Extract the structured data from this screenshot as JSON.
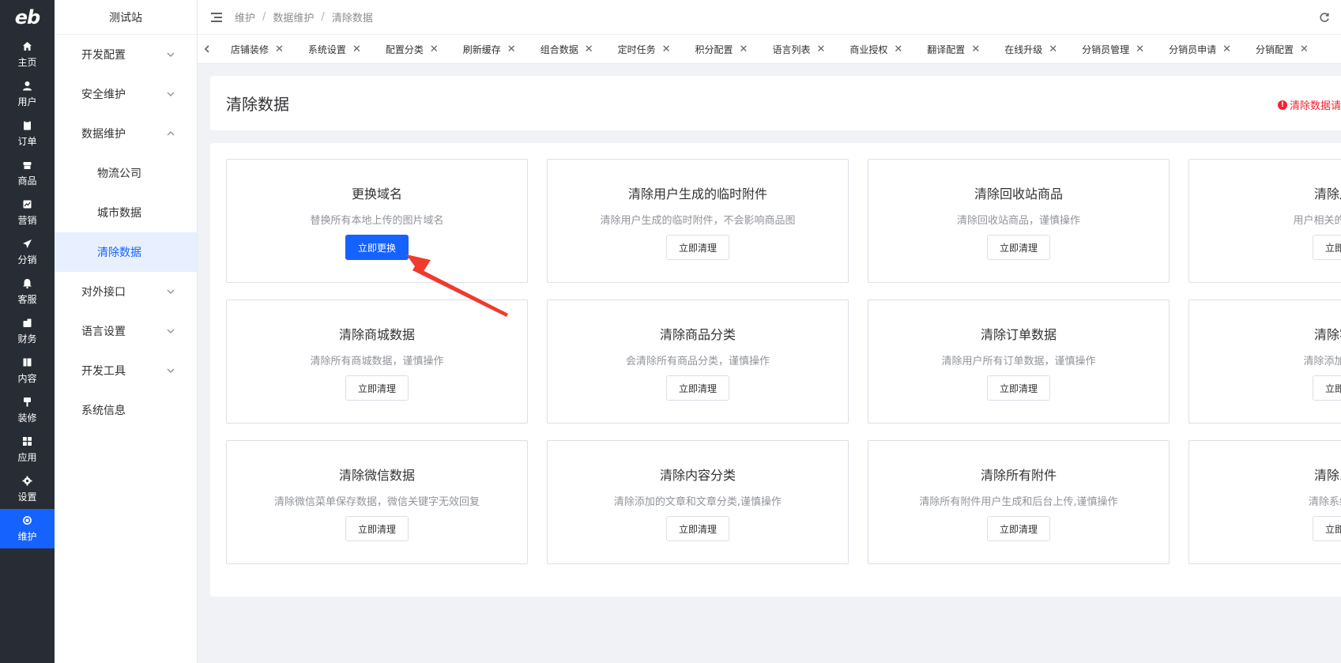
{
  "rail": {
    "logo": "eb",
    "items": [
      {
        "label": "主页",
        "icon": "home-icon"
      },
      {
        "label": "用户",
        "icon": "user-icon"
      },
      {
        "label": "订单",
        "icon": "order-icon"
      },
      {
        "label": "商品",
        "icon": "goods-icon"
      },
      {
        "label": "营销",
        "icon": "marketing-icon"
      },
      {
        "label": "分销",
        "icon": "send-icon"
      },
      {
        "label": "客服",
        "icon": "bell-icon"
      },
      {
        "label": "财务",
        "icon": "finance-icon"
      },
      {
        "label": "内容",
        "icon": "content-icon"
      },
      {
        "label": "装修",
        "icon": "decorate-icon"
      },
      {
        "label": "应用",
        "icon": "apps-grid-icon"
      },
      {
        "label": "设置",
        "icon": "gear-icon"
      },
      {
        "label": "维护",
        "icon": "maintenance-icon"
      }
    ],
    "active_index": 12
  },
  "subnav": {
    "title": "测试站",
    "groups": {
      "dev_config": "开发配置",
      "security": "安全维护",
      "data": "数据维护",
      "data_children": [
        "物流公司",
        "城市数据",
        "清除数据"
      ],
      "api": "对外接口",
      "language": "语言设置",
      "devtools": "开发工具",
      "sysinfo": "系统信息"
    }
  },
  "header": {
    "breadcrumb": [
      "维护",
      "数据维护",
      "清除数据"
    ]
  },
  "tabs": [
    "店铺装修",
    "系统设置",
    "配置分类",
    "刷新缓存",
    "组合数据",
    "定时任务",
    "积分配置",
    "语言列表",
    "商业授权",
    "翻译配置",
    "在线升级",
    "分销员管理",
    "分销员申请",
    "分销配置"
  ],
  "page": {
    "title": "清除数据",
    "warning": "清除数据请"
  },
  "cards": [
    {
      "title": "更换域名",
      "desc": "替换所有本地上传的图片域名",
      "button": "立即更换",
      "primary": true
    },
    {
      "title": "清除用户生成的临时附件",
      "desc": "清除用户生成的临时附件，不会影响商品图",
      "button": "立即清理"
    },
    {
      "title": "清除回收站商品",
      "desc": "清除回收站商品，谨慎操作",
      "button": "立即清理"
    },
    {
      "title": "清除用户",
      "desc": "用户相关的所有表都",
      "button": "立即清"
    },
    {
      "title": "清除商城数据",
      "desc": "清除所有商城数据，谨慎操作",
      "button": "立即清理"
    },
    {
      "title": "清除商品分类",
      "desc": "会清除所有商品分类，谨慎操作",
      "button": "立即清理"
    },
    {
      "title": "清除订单数据",
      "desc": "清除用户所有订单数据，谨慎操作",
      "button": "立即清理"
    },
    {
      "title": "清除客服",
      "desc": "清除添加的客服",
      "button": "立即清"
    },
    {
      "title": "清除微信数据",
      "desc": "清除微信菜单保存数据，微信关键字无效回复",
      "button": "立即清理"
    },
    {
      "title": "清除内容分类",
      "desc": "清除添加的文章和文章分类,谨慎操作",
      "button": "立即清理"
    },
    {
      "title": "清除所有附件",
      "desc": "清除所有附件用户生成和后台上传,谨慎操作",
      "button": "立即清理"
    },
    {
      "title": "清除系统",
      "desc": "清除系统记录",
      "button": "立即清"
    }
  ],
  "colors": {
    "primary": "#1562ff",
    "rail_bg": "#282c34",
    "warning": "#f5222d",
    "annotation_arrow": "#f03a2e"
  }
}
